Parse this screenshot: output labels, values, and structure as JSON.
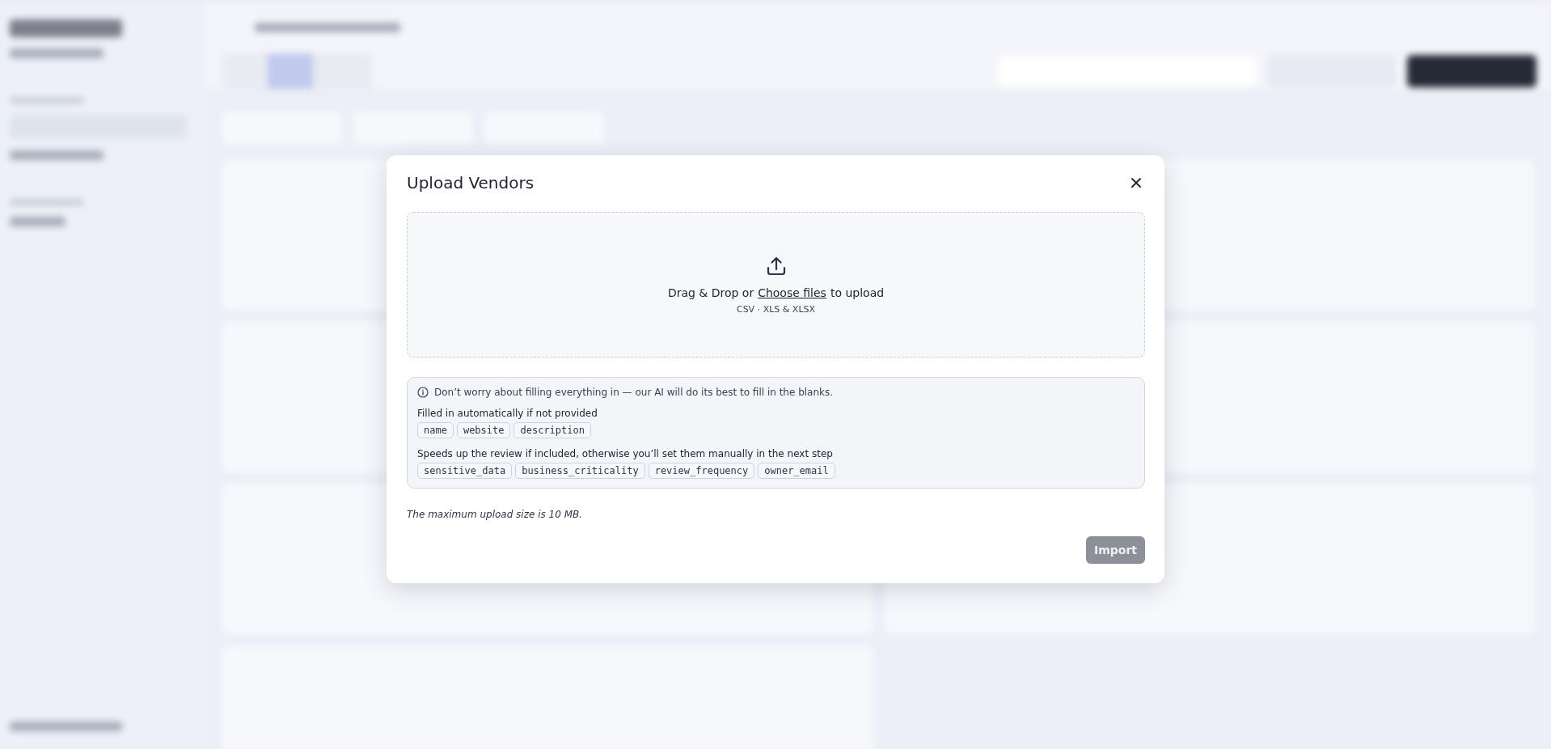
{
  "dialog": {
    "title": "Upload Vendors",
    "dropzone": {
      "before": "Drag & Drop or",
      "link": "Choose files",
      "after": "to upload",
      "formats": "CSV · XLS & XLSX"
    },
    "info": {
      "note": "Don’t worry about filling everything in — our AI will do its best to fill in the blanks.",
      "groups": [
        {
          "heading": "Filled in automatically if not provided",
          "fields": [
            "name",
            "website",
            "description"
          ]
        },
        {
          "heading": "Speeds up the review if included, otherwise you’ll set them manually in the next step",
          "fields": [
            "sensitive_data",
            "business_criticality",
            "review_frequency",
            "owner_email"
          ]
        }
      ]
    },
    "limit": "The maximum upload size is 10 MB.",
    "import_button": {
      "label": "Import",
      "disabled": true
    }
  }
}
